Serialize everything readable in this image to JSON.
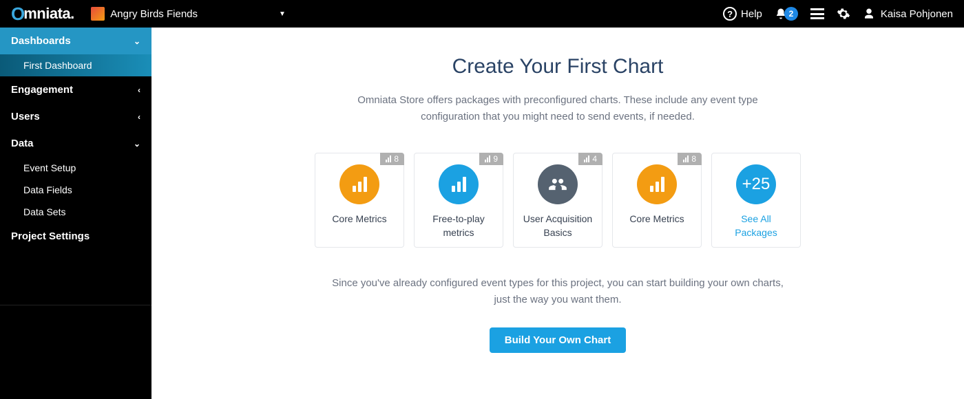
{
  "header": {
    "logo_text": "mniata",
    "project_name": "Angry Birds Fiends",
    "help_label": "Help",
    "notification_count": "2",
    "user_name": "Kaisa Pohjonen"
  },
  "sidebar": {
    "dashboards": "Dashboards",
    "first_dashboard": "First Dashboard",
    "engagement": "Engagement",
    "users": "Users",
    "data": "Data",
    "event_setup": "Event Setup",
    "data_fields": "Data Fields",
    "data_sets": "Data Sets",
    "project_settings": "Project Settings"
  },
  "main": {
    "title": "Create Your First Chart",
    "subtitle": "Omniata Store offers packages with preconfigured charts. These include any event type configuration that you might need to send events, if needed.",
    "bottom_text": "Since you've already configured event types for this project, you can start building your own charts, just the way you want them.",
    "cta": "Build Your Own Chart"
  },
  "cards": [
    {
      "label": "Core Metrics",
      "badge": "8",
      "color": "orange",
      "icon": "bars"
    },
    {
      "label": "Free-to-play metrics",
      "badge": "9",
      "color": "blue",
      "icon": "bars"
    },
    {
      "label": "User Acquisition Basics",
      "badge": "4",
      "color": "dark",
      "icon": "people"
    },
    {
      "label": "Core Metrics",
      "badge": "8",
      "color": "orange",
      "icon": "bars"
    }
  ],
  "more_card": {
    "plus_text": "+25",
    "link_text": "See All Packages"
  }
}
